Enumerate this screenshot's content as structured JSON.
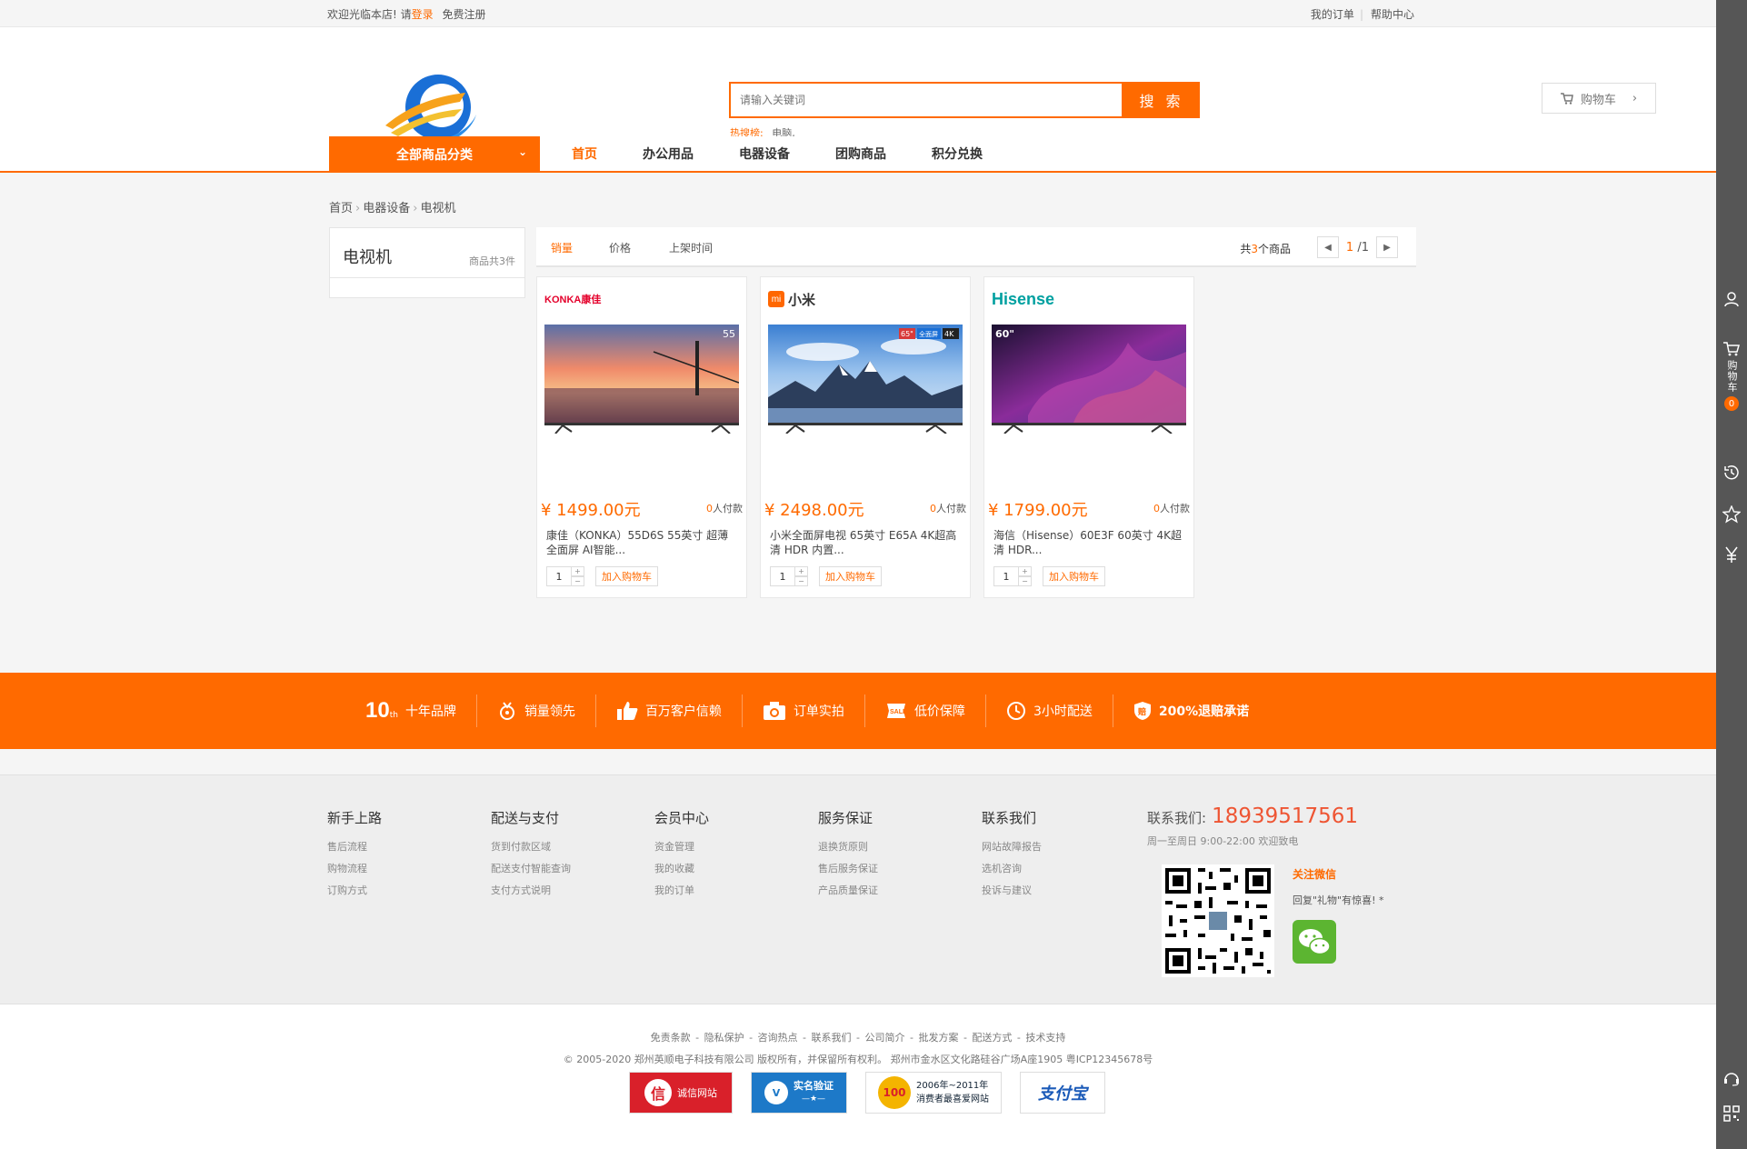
{
  "topbar": {
    "welcome": "欢迎光临本店!",
    "please": "请",
    "login": "登录",
    "register": "免费注册",
    "my_orders": "我的订单",
    "help": "帮助中心"
  },
  "search": {
    "placeholder": "请输入关键词",
    "button": "搜 索",
    "hot_label": "热搜榜:",
    "hot_words": "电脑,"
  },
  "cart_button": "购物车",
  "nav": {
    "all_categories": "全部商品分类",
    "links": [
      "首页",
      "办公用品",
      "电器设备",
      "团购商品",
      "积分兑换"
    ]
  },
  "breadcrumb": [
    "首页",
    "电器设备",
    "电视机"
  ],
  "category": {
    "title": "电视机",
    "count": "商品共3件"
  },
  "sort": {
    "tabs": [
      "销量",
      "价格",
      "上架时间"
    ],
    "total_prefix": "共",
    "total_num": "3",
    "total_suffix": "个商品",
    "page_current": "1",
    "page_total": "/1"
  },
  "products": [
    {
      "brand": "KONKA康佳",
      "price": "¥ 1499.00元",
      "paid_num": "0",
      "paid_label": "人付款",
      "name": "康佳（KONKA）55D6S 55英寸 超薄全面屏 AI智能...",
      "qty": "1",
      "add": "加入购物车",
      "size_tag": "55"
    },
    {
      "brand": "小米",
      "price": "¥ 2498.00元",
      "paid_num": "0",
      "paid_label": "人付款",
      "name": "小米全面屏电视 65英寸 E65A 4K超高清 HDR 内置...",
      "qty": "1",
      "add": "加入购物车",
      "size_tag": "65\"",
      "tag2": "全面屏",
      "tag3": "4K"
    },
    {
      "brand": "Hisense",
      "price": "¥ 1799.00元",
      "paid_num": "0",
      "paid_label": "人付款",
      "name": "海信（Hisense）60E3F 60英寸 4K超清 HDR...",
      "qty": "1",
      "add": "加入购物车",
      "size_tag": "60\""
    }
  ],
  "band": [
    {
      "icon": "ten-years-icon",
      "big": "10",
      "small": "th",
      "label": "十年品牌"
    },
    {
      "icon": "medal-icon",
      "label": "销量领先"
    },
    {
      "icon": "thumbs-up-icon",
      "label": "百万客户信赖"
    },
    {
      "icon": "camera-icon",
      "label": "订单实拍"
    },
    {
      "icon": "sale-icon",
      "label": "低价保障"
    },
    {
      "icon": "clock-icon",
      "label": "3小时配送"
    },
    {
      "icon": "shield-icon",
      "label": "200%退赔承诺"
    }
  ],
  "footer": {
    "columns": [
      {
        "title": "新手上路",
        "links": [
          "售后流程",
          "购物流程",
          "订购方式"
        ]
      },
      {
        "title": "配送与支付",
        "links": [
          "货到付款区域",
          "配送支付智能查询",
          "支付方式说明"
        ]
      },
      {
        "title": "会员中心",
        "links": [
          "资金管理",
          "我的收藏",
          "我的订单"
        ]
      },
      {
        "title": "服务保证",
        "links": [
          "退换货原则",
          "售后服务保证",
          "产品质量保证"
        ]
      },
      {
        "title": "联系我们",
        "links": [
          "网站故障报告",
          "选机咨询",
          "投诉与建议"
        ]
      }
    ],
    "contact_label": "联系我们:",
    "phone": "18939517561",
    "hours": "周一至周日 9:00-22:00 欢迎致电",
    "wechat_title": "关注微信",
    "wechat_tip": "回复\"礼物\"有惊喜! *"
  },
  "bottom": {
    "links": [
      "免责条款",
      "隐私保护",
      "咨询热点",
      "联系我们",
      "公司简介",
      "批发方案",
      "配送方式",
      "技术支持"
    ],
    "copyright": "© 2005-2020 郑州英顺电子科技有限公司 版权所有，并保留所有权利。 郑州市金水区文化路硅谷广场A座1905 粤ICP12345678号",
    "badges": {
      "b1_icon": "信",
      "b1": "诚信网站",
      "b2": "实名验证",
      "b2_sub": "—★—",
      "b3_icon": "100",
      "b3_line1": "2006年~2011年",
      "b3_line2": "消费者最喜爱网站",
      "b4": "支付宝"
    }
  },
  "sidebar": {
    "cart": "购物车",
    "cart_count": "0"
  },
  "colors": {
    "accent": "#ff6a00",
    "phone": "#ee5533"
  }
}
